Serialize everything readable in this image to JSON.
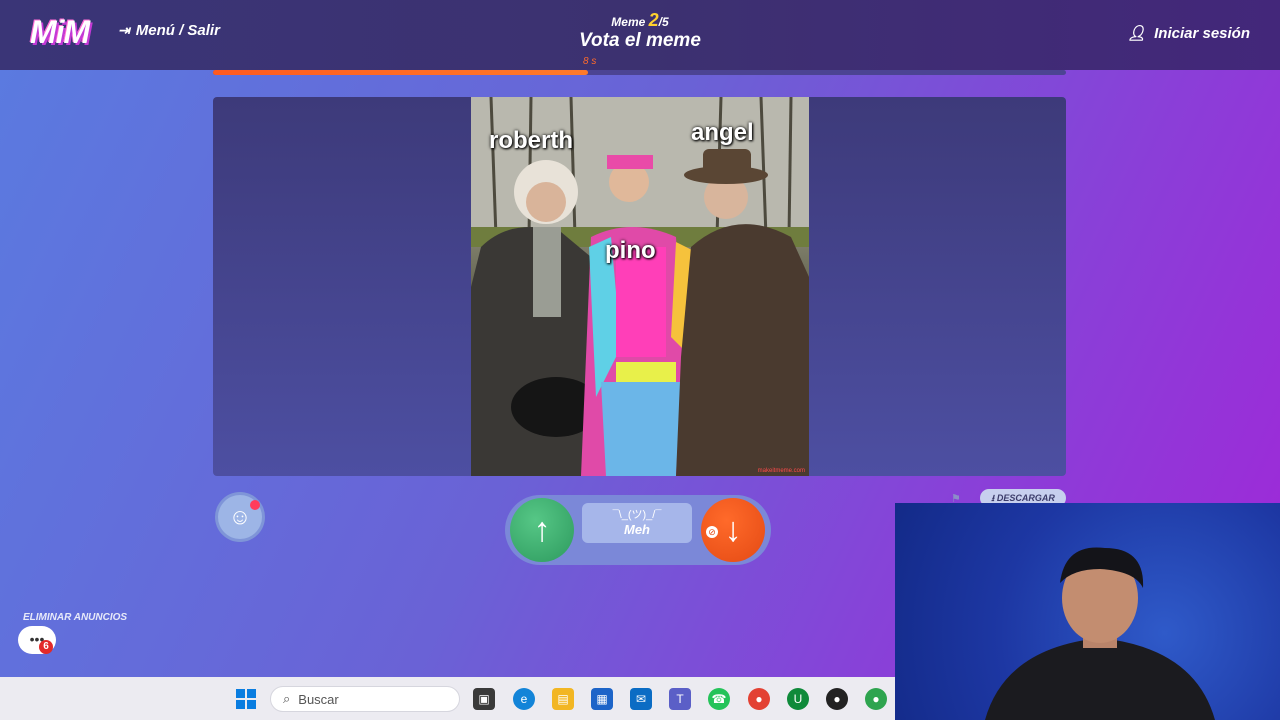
{
  "header": {
    "logo": "MiM",
    "menu_label": "Menú / Salir",
    "meme_label": "Meme",
    "meme_current": "2",
    "meme_total": "/5",
    "title": "Vota el meme",
    "login_label": "Iniciar sesión"
  },
  "progress": {
    "fraction": 0.44,
    "timer": "8 s"
  },
  "meme": {
    "captions": {
      "left": "roberth",
      "middle": "pino",
      "right": "angel"
    },
    "watermark": "makeitmeme.com"
  },
  "controls": {
    "meh_face": "¯\\_(ツ)_/¯",
    "meh_label": "Meh",
    "download_label": "DESCARGAR",
    "remove_ads": "ELIMINAR ANUNCIOS",
    "chat_badge": "6"
  },
  "taskbar": {
    "search_placeholder": "Buscar"
  },
  "colors": {
    "upvote": "#2d9a5e",
    "downvote": "#e44a14",
    "progress": "#ff5a1f"
  }
}
